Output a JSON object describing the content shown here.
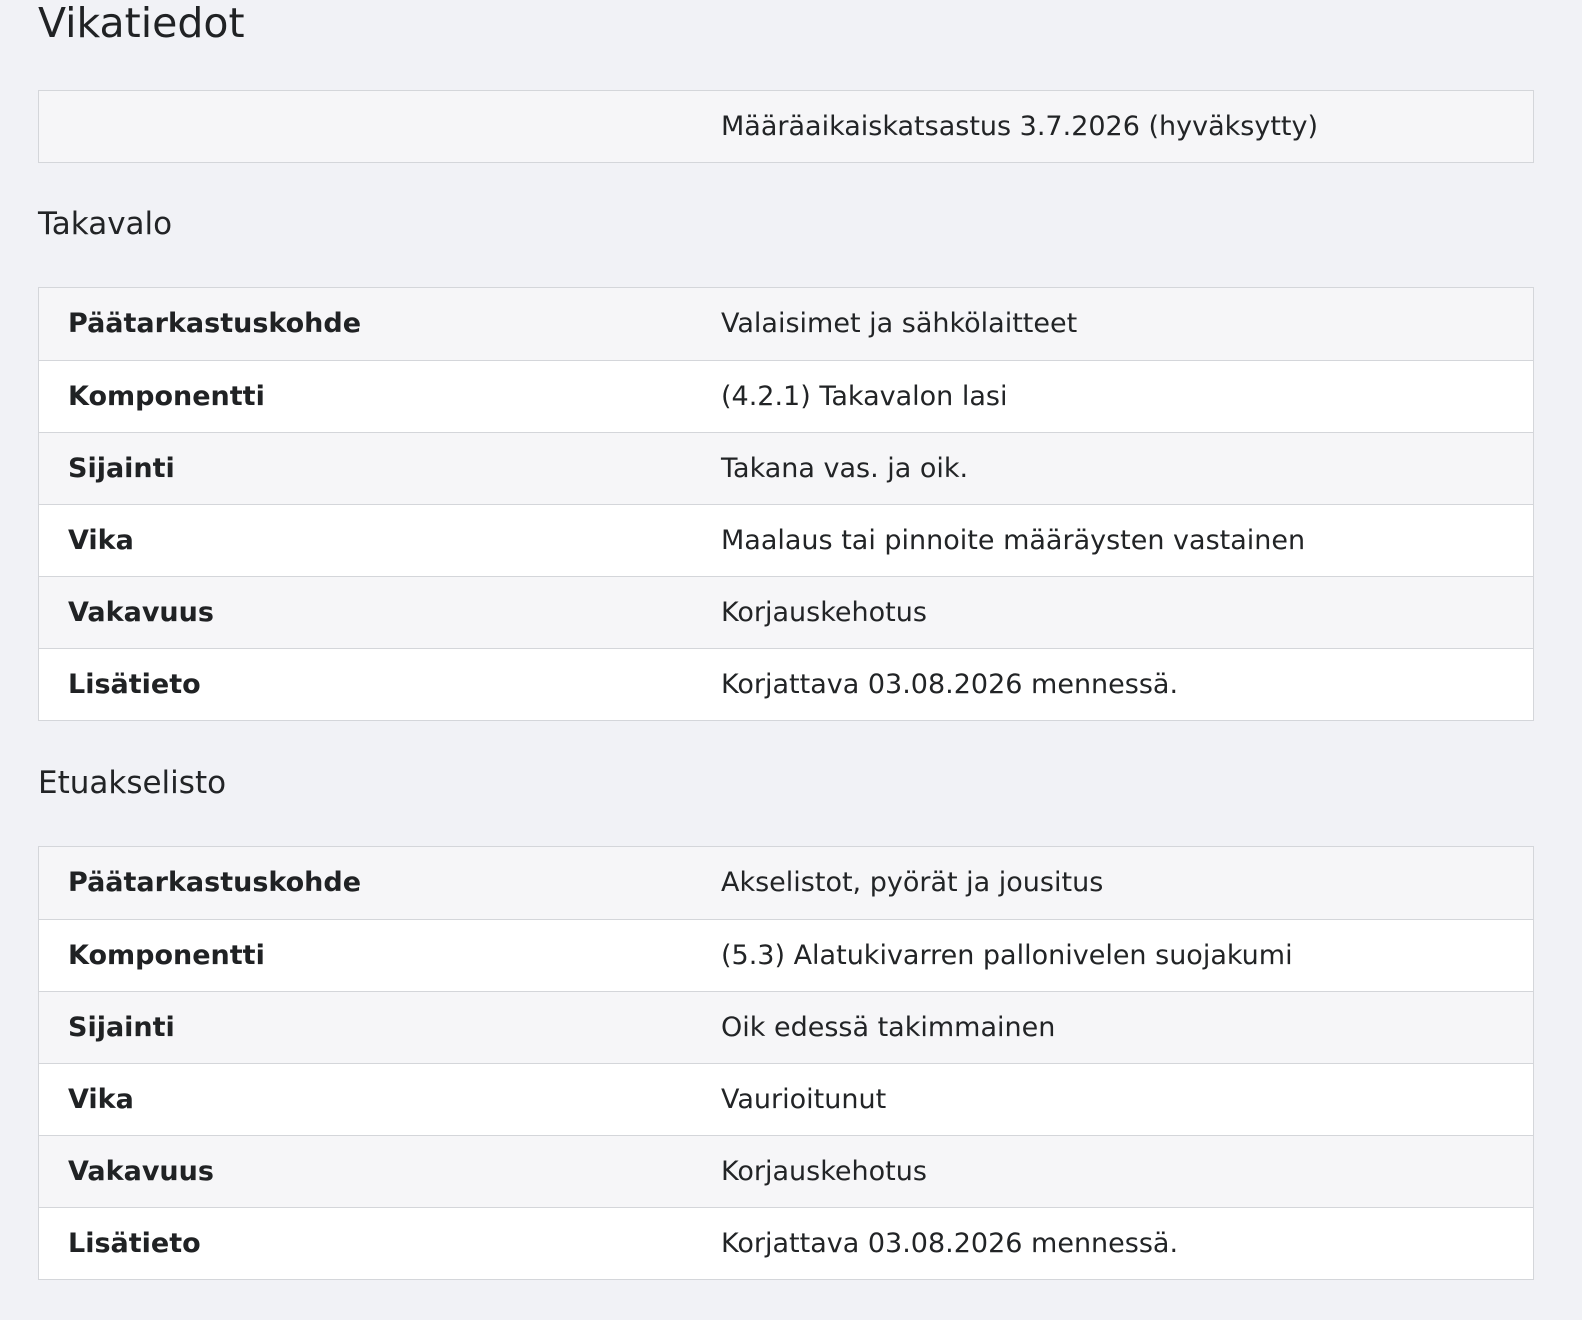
{
  "page": {
    "title": "Vikatiedot"
  },
  "inspection": {
    "summary": "Määräaikaiskatsastus 3.7.2026 (hyväksytty)"
  },
  "defects": [
    {
      "heading": "Takavalo",
      "rows": [
        {
          "label": "Päätarkastuskohde",
          "value": "Valaisimet ja sähkölaitteet"
        },
        {
          "label": "Komponentti",
          "value": "(4.2.1) Takavalon lasi"
        },
        {
          "label": "Sijainti",
          "value": "Takana vas. ja oik."
        },
        {
          "label": "Vika",
          "value": "Maalaus tai pinnoite määräysten vastainen"
        },
        {
          "label": "Vakavuus",
          "value": "Korjauskehotus"
        },
        {
          "label": "Lisätieto",
          "value": "Korjattava 03.08.2026 mennessä."
        }
      ]
    },
    {
      "heading": "Etuakselisto",
      "rows": [
        {
          "label": "Päätarkastuskohde",
          "value": "Akselistot, pyörät ja jousitus"
        },
        {
          "label": "Komponentti",
          "value": "(5.3) Alatukivarren pallonivelen suojakumi"
        },
        {
          "label": "Sijainti",
          "value": "Oik edessä takimmainen"
        },
        {
          "label": "Vika",
          "value": "Vaurioitunut"
        },
        {
          "label": "Vakavuus",
          "value": "Korjauskehotus"
        },
        {
          "label": "Lisätieto",
          "value": "Korjattava 03.08.2026 mennessä."
        }
      ]
    }
  ]
}
